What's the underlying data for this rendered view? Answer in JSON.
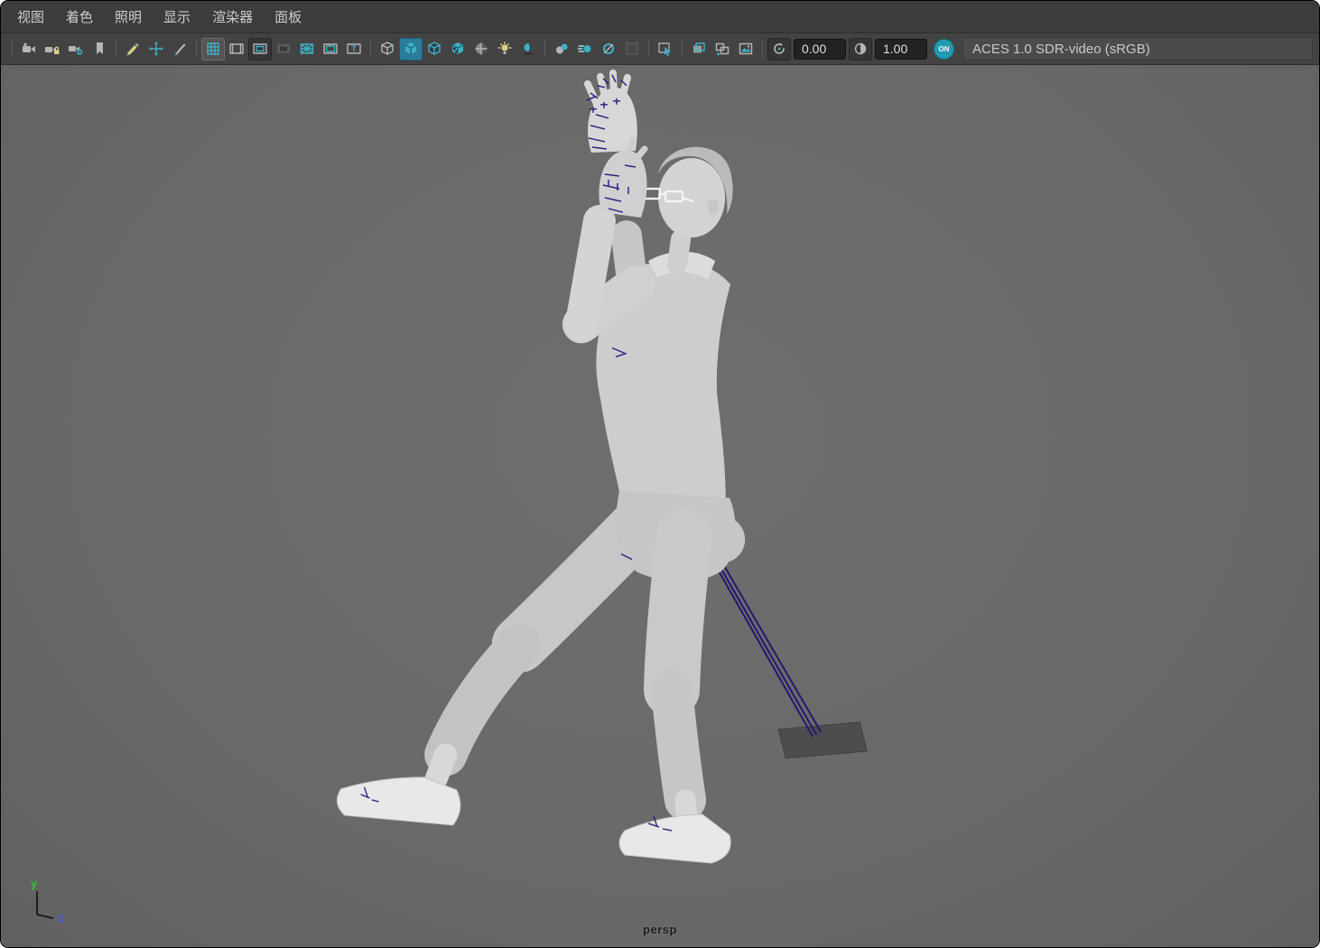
{
  "colors": {
    "menubar-bg": "#3c3c3c",
    "toolbar-bg": "#434343",
    "viewport-bg": "#6b6b6b",
    "accent-teal": "#3fb0c4",
    "icon-gray": "#b5b5b5",
    "active-bg": "#2c7d9c",
    "field-bg": "#222222",
    "text-light": "#cccccc",
    "colorspace-bg": "#4b4b4b",
    "axis-y": "#35c135",
    "axis-z": "#4b5fe8"
  },
  "menubar": {
    "items": [
      {
        "label": "视图"
      },
      {
        "label": "着色"
      },
      {
        "label": "照明"
      },
      {
        "label": "显示"
      },
      {
        "label": "渲染器"
      },
      {
        "label": "面板"
      }
    ]
  },
  "toolbar": {
    "icons": [
      "select-camera",
      "lock-camera",
      "camera-attributes",
      "bookmarks",
      "grease-pencil",
      "pan-zoom",
      "paint-tool",
      "grid",
      "film-gate",
      "resolution-gate",
      "gate-mask",
      "field-chart",
      "safe-action",
      "safe-title",
      "wireframe",
      "smooth-shade-all",
      "wireframe-on-shaded",
      "textured",
      "use-default-material",
      "use-all-lights",
      "shadows",
      "ambient-occlusion",
      "motion-blur",
      "anti-aliasing",
      "extra-option",
      "isolate-select",
      "frame-copy",
      "frame-swap",
      "image-output",
      "exposure",
      "gamma",
      "color-management-on"
    ],
    "exposure": {
      "value": "0.00"
    },
    "gamma": {
      "value": "1.00"
    },
    "color_management": {
      "on_label": "ON",
      "colorspace": "ACES 1.0 SDR-video (sRGB)"
    }
  },
  "viewport": {
    "camera_label": "persp",
    "axis": {
      "y": "y",
      "z": "z"
    },
    "scene_description": "gray shaded humanoid character in dynamic pose with dark-blue rig control curves on hands, a curve from hip to a dark ground plane"
  }
}
